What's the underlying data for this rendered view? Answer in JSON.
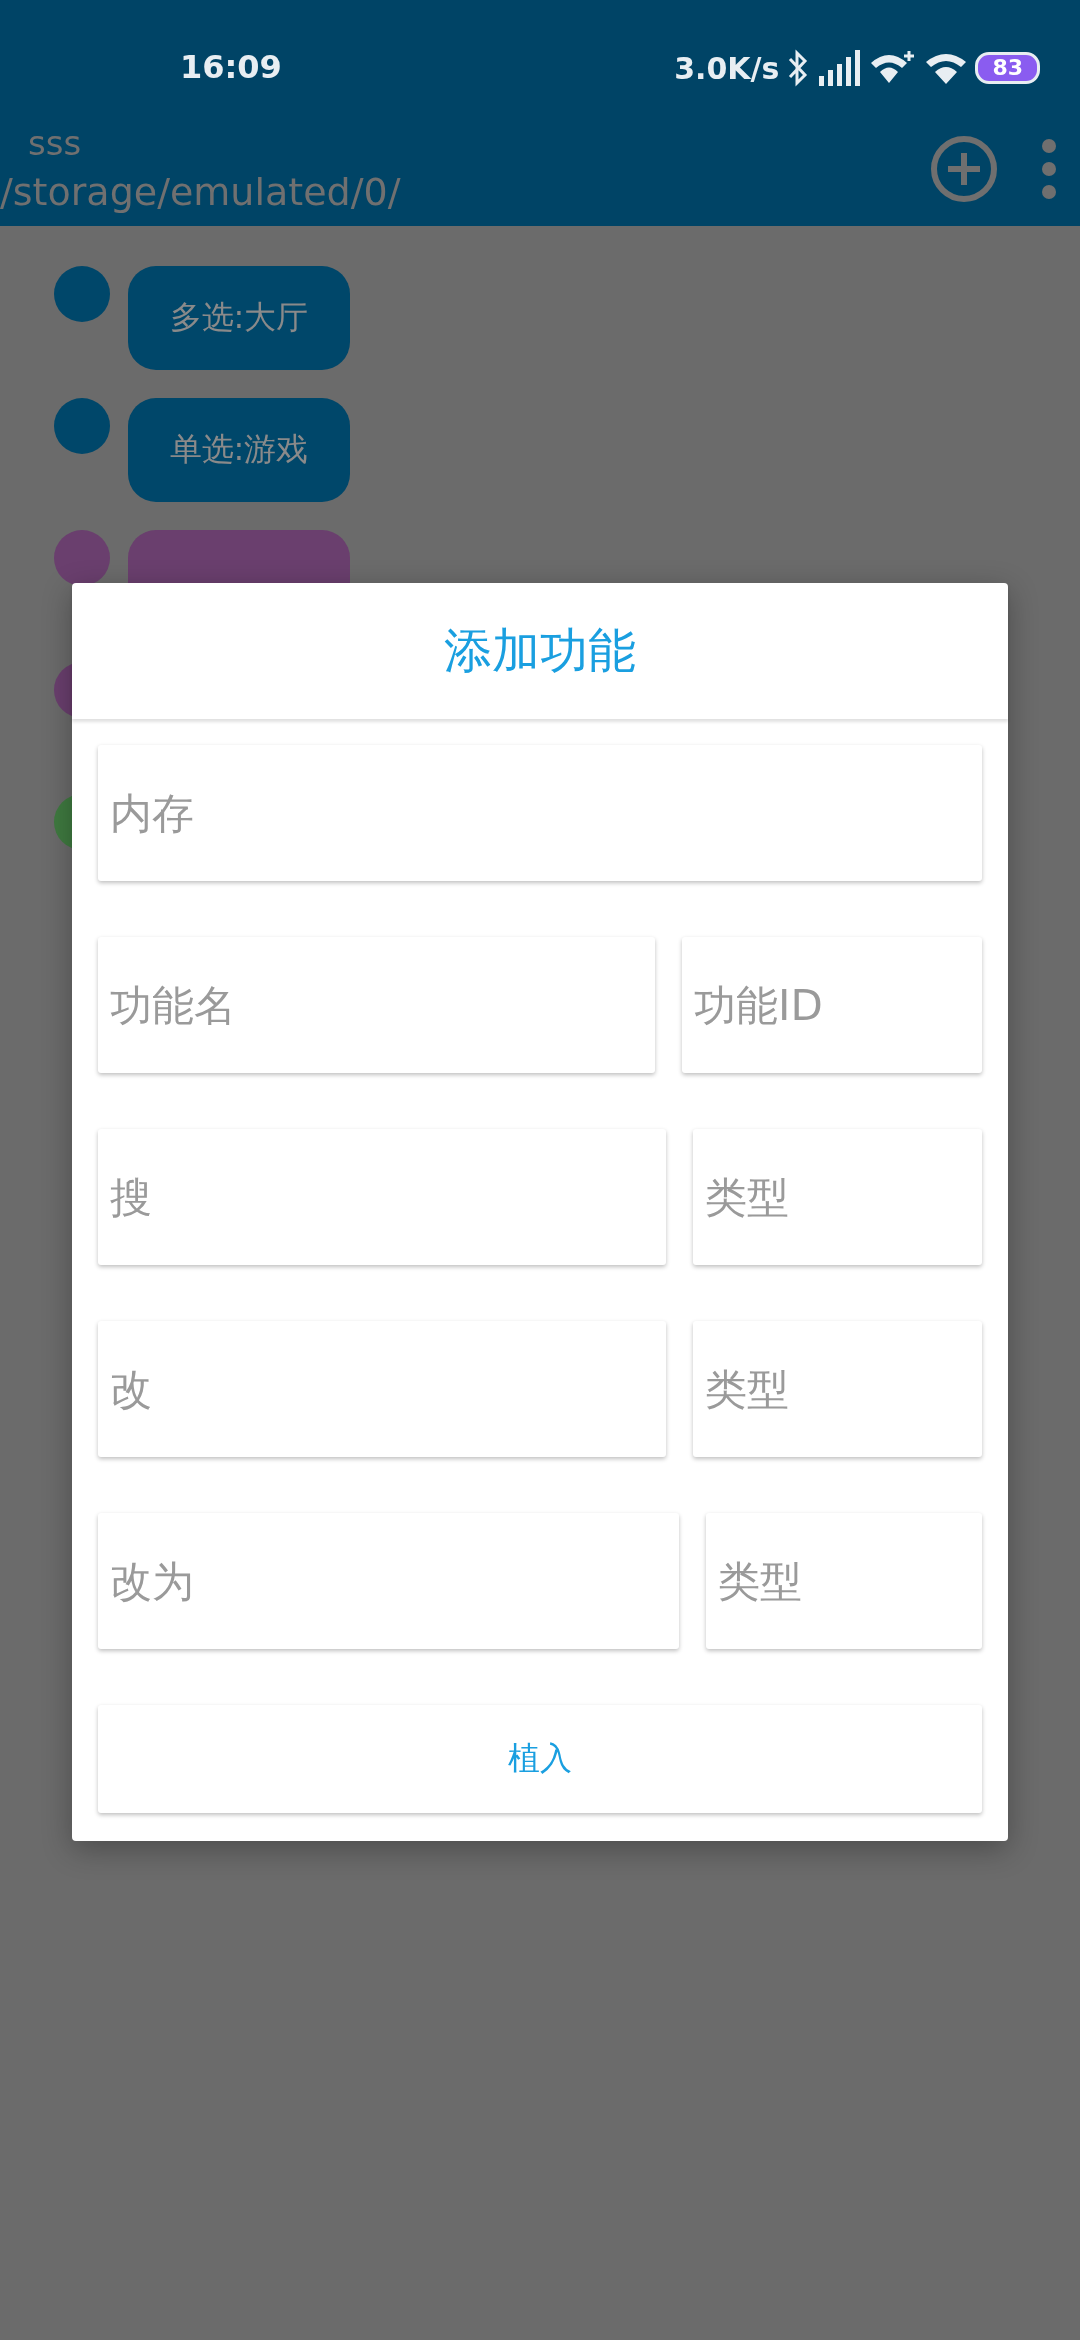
{
  "status_bar": {
    "time": "16:09",
    "net_speed": "3.0K/s",
    "battery": "83"
  },
  "app_bar": {
    "title": "sss",
    "subtitle": "/storage/emulated/0/"
  },
  "items": [
    {
      "kind": "chip",
      "label": "多选:大厅",
      "color": "#00476a"
    },
    {
      "kind": "chip",
      "label": "单选:游戏",
      "color": "#00476a"
    },
    {
      "kind": "chip",
      "color": "#6a3f6e"
    },
    {
      "kind": "dot",
      "color": "#6a3f6e"
    },
    {
      "kind": "dot",
      "color": "#3f7a40"
    }
  ],
  "dialog": {
    "title": "添加功能",
    "rows": [
      [
        {
          "placeholder": "内存"
        }
      ],
      [
        {
          "placeholder": "功能名"
        },
        {
          "placeholder": "功能ID"
        }
      ],
      [
        {
          "placeholder": "搜"
        },
        {
          "placeholder": "类型"
        }
      ],
      [
        {
          "placeholder": "改"
        },
        {
          "placeholder": "类型"
        }
      ],
      [
        {
          "placeholder": "改为"
        },
        {
          "placeholder": "类型"
        }
      ]
    ],
    "button": "植入"
  }
}
